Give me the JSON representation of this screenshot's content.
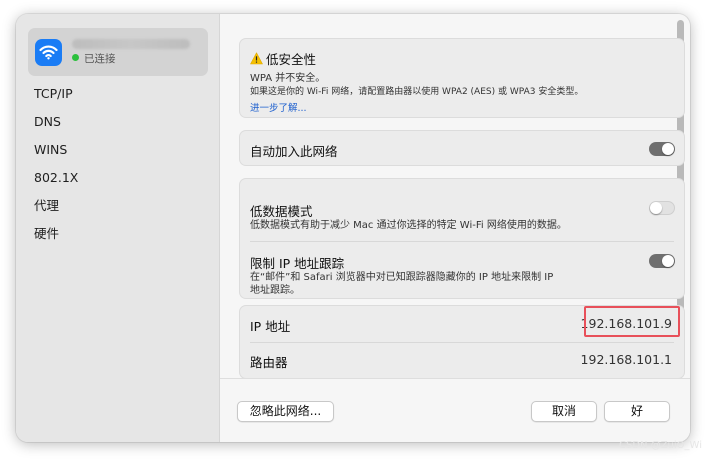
{
  "sidebar": {
    "network_status": "已连接",
    "items": [
      {
        "label": "TCP/IP"
      },
      {
        "label": "DNS"
      },
      {
        "label": "WINS"
      },
      {
        "label": "802.1X"
      },
      {
        "label": "代理"
      },
      {
        "label": "硬件"
      }
    ]
  },
  "security": {
    "title": "低安全性",
    "subtitle": "WPA 并不安全。",
    "description": "如果这是你的 Wi-Fi 网络，请配置路由器以使用 WPA2 (AES) 或 WPA3 安全类型。",
    "link": "进一步了解..."
  },
  "auto_join": {
    "label": "自动加入此网络",
    "enabled": true
  },
  "low_data": {
    "label": "低数据模式",
    "description": "低数据模式有助于减少 Mac 通过你选择的特定 Wi-Fi 网络使用的数据。",
    "enabled": false
  },
  "limit_ip": {
    "label": "限制 IP 地址跟踪",
    "description_line1": "在“邮件”和 Safari 浏览器中对已知跟踪器隐藏你的 IP 地址来限制 IP",
    "description_line2": "地址跟踪。",
    "enabled": true
  },
  "ip": {
    "label": "IP 地址",
    "value": "192.168.101.9"
  },
  "router": {
    "label": "路由器",
    "value": "192.168.101.1"
  },
  "footer": {
    "forget_label": "忽略此网络...",
    "cancel_label": "取消",
    "ok_label": "好"
  },
  "watermark": "CSDN @ZuiO_Wi",
  "colors": {
    "accent": "#1a7cf5",
    "highlight": "#e8505a",
    "status_green": "#2bc03c"
  },
  "icons": {
    "network": "wifi-icon",
    "security": "warning-icon"
  }
}
